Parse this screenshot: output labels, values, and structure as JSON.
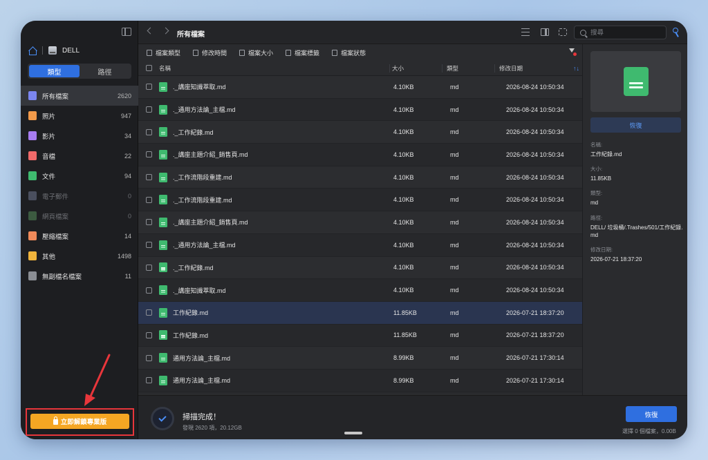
{
  "sidebar": {
    "device_name": "DELL",
    "segments": [
      "類型",
      "路徑"
    ],
    "categories": [
      {
        "label": "所有檔案",
        "count": "2620",
        "color": "#7b86f0"
      },
      {
        "label": "照片",
        "count": "947",
        "color": "#f29a4a"
      },
      {
        "label": "影片",
        "count": "34",
        "color": "#a77cf0"
      },
      {
        "label": "音檔",
        "count": "22",
        "color": "#f06a6a"
      },
      {
        "label": "文件",
        "count": "94",
        "color": "#3fba6f"
      },
      {
        "label": "電子郵件",
        "count": "0",
        "color": "#4a4f5e"
      },
      {
        "label": "網頁檔案",
        "count": "0",
        "color": "#3c5a40"
      },
      {
        "label": "壓縮檔案",
        "count": "14",
        "color": "#f08a5a"
      },
      {
        "label": "其他",
        "count": "1498",
        "color": "#f0b43c"
      },
      {
        "label": "無副檔名檔案",
        "count": "11",
        "color": "#8a8d93"
      }
    ],
    "unlock_label": "立即解鎖專業版"
  },
  "toolbar": {
    "title": "所有檔案",
    "search_placeholder": "搜尋"
  },
  "filters": [
    "檔案類型",
    "修改時間",
    "檔案大小",
    "檔案標籤",
    "檔案狀態"
  ],
  "table": {
    "headers": {
      "name": "名稱",
      "size": "大小",
      "type": "類型",
      "date": "修改日期"
    },
    "sort_glyph": "↑↓",
    "rows": [
      {
        "name": "._講座知識萃取.md",
        "size": "4.10KB",
        "type": "md",
        "date": "2026-08-24 10:50:34"
      },
      {
        "name": "._通用方法論_主檔.md",
        "size": "4.10KB",
        "type": "md",
        "date": "2026-08-24 10:50:34"
      },
      {
        "name": "._工作紀錄.md",
        "size": "4.10KB",
        "type": "md",
        "date": "2026-08-24 10:50:34"
      },
      {
        "name": "._講座主題介紹_銷售頁.md",
        "size": "4.10KB",
        "type": "md",
        "date": "2026-08-24 10:50:34"
      },
      {
        "name": "._工作流階段重建.md",
        "size": "4.10KB",
        "type": "md",
        "date": "2026-08-24 10:50:34"
      },
      {
        "name": "._工作流階段重建.md",
        "size": "4.10KB",
        "type": "md",
        "date": "2026-08-24 10:50:34"
      },
      {
        "name": "._講座主題介紹_銷售頁.md",
        "size": "4.10KB",
        "type": "md",
        "date": "2026-08-24 10:50:34"
      },
      {
        "name": "._通用方法論_主檔.md",
        "size": "4.10KB",
        "type": "md",
        "date": "2026-08-24 10:50:34"
      },
      {
        "name": "._工作紀錄.md",
        "size": "4.10KB",
        "type": "md",
        "date": "2026-08-24 10:50:34"
      },
      {
        "name": "._講座知識萃取.md",
        "size": "4.10KB",
        "type": "md",
        "date": "2026-08-24 10:50:34"
      },
      {
        "name": "工作紀錄.md",
        "size": "11.85KB",
        "type": "md",
        "date": "2026-07-21 18:37:20"
      },
      {
        "name": "工作紀錄.md",
        "size": "11.85KB",
        "type": "md",
        "date": "2026-07-21 18:37:20"
      },
      {
        "name": "通用方法論_主檔.md",
        "size": "8.99KB",
        "type": "md",
        "date": "2026-07-21 17:30:14"
      },
      {
        "name": "通用方法論_主檔.md",
        "size": "8.99KB",
        "type": "md",
        "date": "2026-07-21 17:30:14"
      }
    ]
  },
  "preview": {
    "recover_label": "恢復",
    "name_label": "名稱:",
    "name_value": "工作紀錄.md",
    "size_label": "大小:",
    "size_value": "11.85KB",
    "type_label": "類型:",
    "type_value": "md",
    "path_label": "路徑:",
    "path_value": "DELL/ 垃圾桶/.Trashes/501/工作紀錄.md",
    "date_label": "修改日期:",
    "date_value": "2026-07-21 18:37:20"
  },
  "bottom": {
    "scan_title": "掃描完成！",
    "scan_sub": "發現 2620 項，20.12GB",
    "recover_label": "恢復",
    "selected_info": "選擇 0 個檔案，0.00B"
  },
  "colors": {
    "accent": "#2f6fe0",
    "annotation": "#e8363b",
    "unlock": "#f5a623"
  }
}
